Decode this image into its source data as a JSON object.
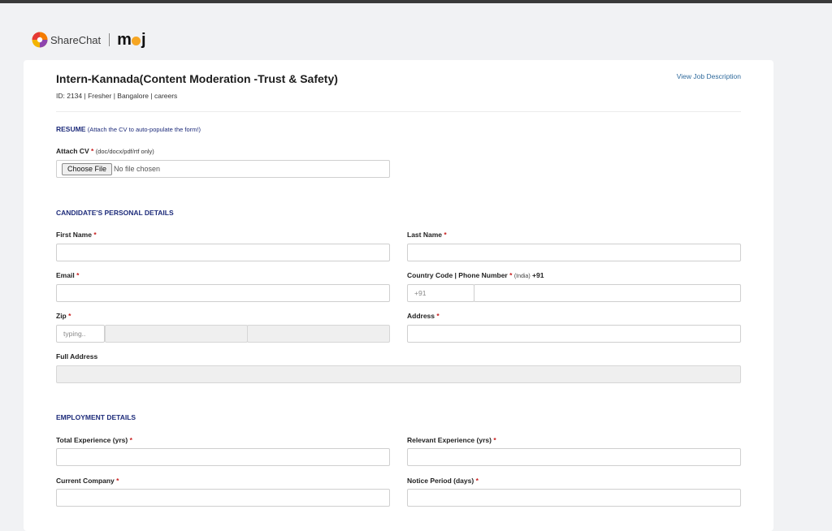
{
  "brand": {
    "sharechat": "ShareChat",
    "moj": [
      "m",
      "j"
    ]
  },
  "job": {
    "title": "Intern-Kannada(Content Moderation -Trust & Safety)",
    "meta": "ID: 2134 | Fresher | Bangalore | careers",
    "view_jd": "View Job Description"
  },
  "resume": {
    "heading": "RESUME",
    "hint": "(Attach the CV to auto-populate the form!)",
    "attach_label": "Attach CV",
    "req": "*",
    "formats": "(doc/docx/pdf/rtf only)",
    "choose_file": "Choose File",
    "no_file": "No file chosen"
  },
  "personal": {
    "heading": "CANDIDATE'S PERSONAL DETAILS",
    "first_name": "First Name",
    "last_name": "Last Name",
    "email": "Email",
    "phone_label": "Country Code | Phone Number",
    "phone_country": "(India)",
    "phone_code_bold": "+91",
    "phone_code_value": "+91",
    "zip": "Zip",
    "zip_placeholder": "typing..",
    "address": "Address",
    "full_address": "Full Address",
    "req": "*"
  },
  "employment": {
    "heading": "EMPLOYMENT DETAILS",
    "total_exp": "Total Experience (yrs)",
    "relevant_exp": "Relevant Experience (yrs)",
    "current_company": "Current Company",
    "notice_period": "Notice Period (days)",
    "req": "*"
  },
  "colors": {
    "accent": "#1d2b7a",
    "required": "#c81e1e",
    "link": "#2f6a9c",
    "moj_dot": "#f6a623"
  },
  "icons": [
    "sharechat-logo-icon",
    "moj-logo-icon"
  ]
}
